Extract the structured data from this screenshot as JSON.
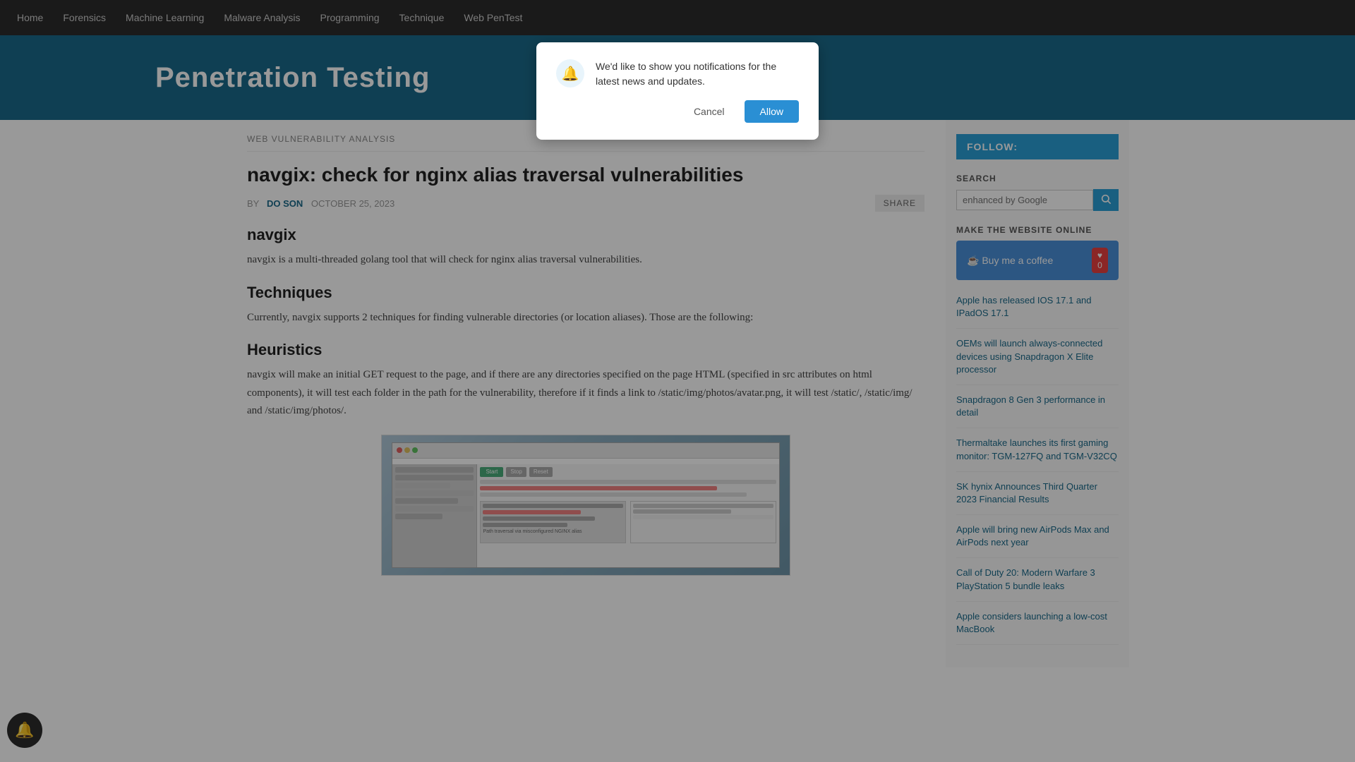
{
  "nav": {
    "items": [
      {
        "label": "Home",
        "id": "home"
      },
      {
        "label": "Forensics",
        "id": "forensics"
      },
      {
        "label": "Machine Learning",
        "id": "machine-learning"
      },
      {
        "label": "Malware Analysis",
        "id": "malware-analysis"
      },
      {
        "label": "Programming",
        "id": "programming"
      },
      {
        "label": "Technique",
        "id": "technique"
      },
      {
        "label": "Web PenTest",
        "id": "web-pentest"
      }
    ]
  },
  "header": {
    "site_title": "Penetration Testing"
  },
  "breadcrumb": {
    "text": "WEB VULNERABILITY ANALYSIS"
  },
  "article": {
    "title": "navgix: check for nginx alias traversal vulnerabilities",
    "meta": {
      "by_label": "BY",
      "author": "DO SON",
      "date": "OCTOBER 25, 2023",
      "share_label": "SHARE"
    },
    "section1_title": "navgix",
    "section1_text": "navgix is a multi-threaded golang tool that will check for nginx alias traversal vulnerabilities.",
    "section2_title": "Techniques",
    "section2_text": "Currently, navgix supports 2 techniques for finding vulnerable directories (or location aliases). Those are the following:",
    "section3_title": "Heuristics",
    "section3_text_part1": "navgix will make an initial GET request to the page, and if there are any directories specified on the page HTML (specified in src attributes on html components), it will test each folder in the path for the vulnerability, therefore if it finds a link to /static/img/photos/avatar.png, it will test /static/, /static/img/ and /static/img/photos/.",
    "vulnerabilities_link": "vulnerabilities"
  },
  "modal": {
    "bell_icon": "🔔",
    "text": "We'd like to show you notifications for the latest news and updates.",
    "cancel_label": "Cancel",
    "allow_label": "Allow"
  },
  "sidebar": {
    "follow_label": "FOLLOW:",
    "search": {
      "label": "SEARCH",
      "placeholder": "enhanced by Google",
      "btn_icon": "🔍"
    },
    "make_online": {
      "label": "MAKE THE WEBSITE ONLINE",
      "btn_label": "Buy me a coffee",
      "coffee_icon": "☕",
      "heart_icon": "♥",
      "heart_count": "0"
    },
    "articles": [
      {
        "text": "Apple has released IOS 17.1 and IPadOS 17.1"
      },
      {
        "text": "OEMs will launch always-connected devices using Snapdragon X Elite processor"
      },
      {
        "text": "Snapdragon 8 Gen 3 performance in detail"
      },
      {
        "text": "Thermaltake launches its first gaming monitor: TGM-127FQ and TGM-V32CQ"
      },
      {
        "text": "SK hynix Announces Third Quarter 2023 Financial Results"
      },
      {
        "text": "Apple will bring new AirPods Max and AirPods next year"
      },
      {
        "text": "Call of Duty 20: Modern Warfare 3 PlayStation 5 bundle leaks"
      },
      {
        "text": "Apple considers launching a low-cost MacBook"
      }
    ]
  },
  "notif_bell": "🔔"
}
